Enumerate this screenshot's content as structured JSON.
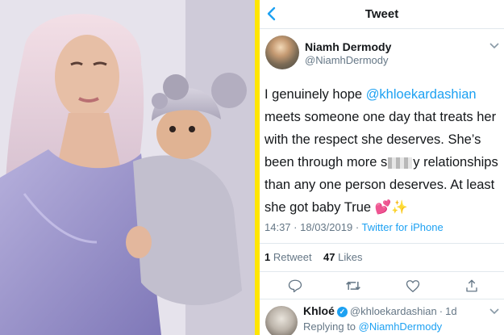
{
  "header": {
    "title": "Tweet",
    "back_icon": "back-arrow-icon"
  },
  "tweet": {
    "author_name": "Niamh Dermody",
    "author_handle": "@NiamhDermody",
    "text_before": "I genuinely hope ",
    "mention": "@khloekardashian",
    "text_line_1": " meets someone one day that treats her with the respect she deserves. She’s been through more s",
    "text_after_censor": "y relationships than any one person deserves. At least she got baby True ",
    "emojis": "💕✨",
    "time": "14:37",
    "date": "18/03/2019",
    "source": "Twitter for iPhone",
    "retweets_count": "1",
    "retweets_label": "Retweet",
    "likes_count": "47",
    "likes_label": "Likes"
  },
  "reply": {
    "name": "Khloé",
    "handle": "@khloekardashian",
    "age": "1d",
    "replying_label": "Replying to",
    "replying_to": "@NiamhDermody"
  },
  "colors": {
    "accent": "#1da1f2",
    "divider": "#ffe600",
    "text": "#14171a",
    "muted": "#657786"
  }
}
